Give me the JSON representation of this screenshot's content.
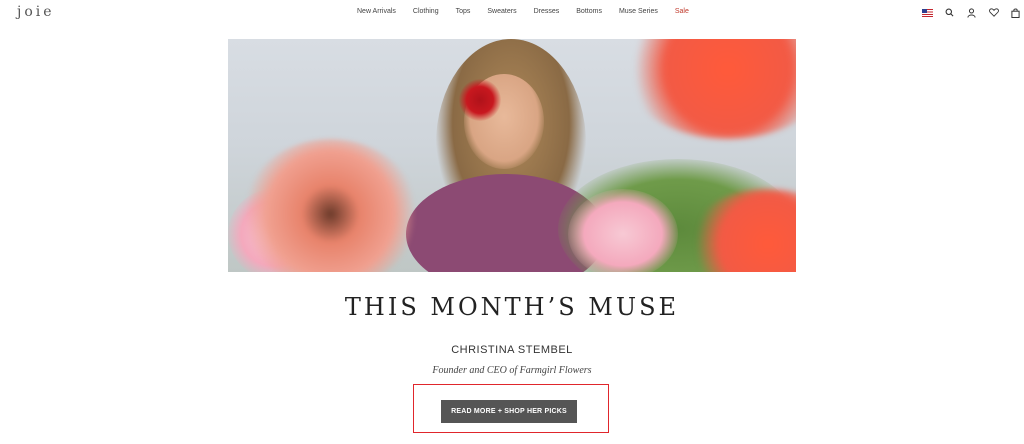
{
  "header": {
    "logo": "joie",
    "nav": [
      {
        "label": "New Arrivals"
      },
      {
        "label": "Clothing"
      },
      {
        "label": "Tops"
      },
      {
        "label": "Sweaters"
      },
      {
        "label": "Dresses"
      },
      {
        "label": "Bottoms"
      },
      {
        "label": "Muse Series"
      },
      {
        "label": "Sale"
      }
    ],
    "icons": [
      "us-flag-icon",
      "search-icon",
      "account-icon",
      "wishlist-heart-icon",
      "shopping-bag-icon"
    ]
  },
  "feature": {
    "title": "THIS MONTH’S MUSE",
    "name": "CHRISTINA STEMBEL",
    "role": "Founder and CEO of Farmgirl Flowers",
    "cta_label": "READ MORE + SHOP HER PICKS"
  },
  "colors": {
    "sale": "#c0392b",
    "cta_bg": "#555555",
    "highlight": "#e0262c"
  }
}
